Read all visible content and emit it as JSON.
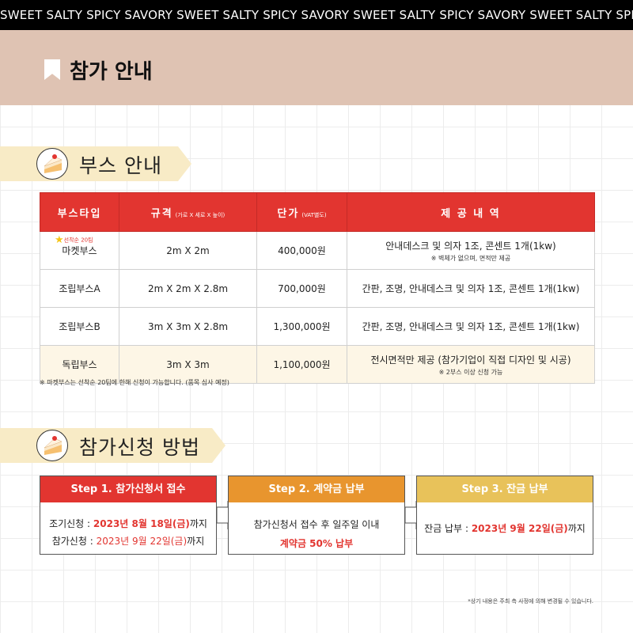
{
  "marquee": "SWEET SALTY SPICY SAVORY SWEET SALTY SPICY SAVORY SWEET SALTY SPICY SAVORY SWEET SALTY SPICY SAVORY",
  "header": {
    "title": "참가 안내"
  },
  "booth_section": {
    "title": "부스 안내"
  },
  "booth_table": {
    "headers": {
      "type": "부스타입",
      "size": "규격",
      "size_sub": "(가로 X 세로 X 높이)",
      "price": "단가",
      "price_sub": "(VAT별도)",
      "provide": "제 공 내 역"
    },
    "rows": [
      {
        "type": "마켓부스",
        "badge": "선착순 20팀",
        "size": "2m X 2m",
        "price": "400,000원",
        "provide": "안내데스크 및 의자 1조, 콘센트 1개(1kw)",
        "provide_sub": "※ 벽체가 없으며, 면적만 제공"
      },
      {
        "type": "조립부스A",
        "size": "2m X 2m X 2.8m",
        "price": "700,000원",
        "provide": "간판, 조명, 안내데스크 및 의자 1조, 콘센트 1개(1kw)"
      },
      {
        "type": "조립부스B",
        "size": "3m X 3m X 2.8m",
        "price": "1,300,000원",
        "provide": "간판, 조명, 안내데스크 및 의자 1조, 콘센트 1개(1kw)"
      },
      {
        "type": "독립부스",
        "size": "3m X 3m",
        "price": "1,100,000원",
        "provide": "전시면적만 제공 (참가기업이 직접 디자인 및 시공)",
        "provide_sub": "※ 2부스 이상 신청 가능"
      }
    ],
    "note": "※ 마켓부스는 선착순 20팀에 한해 신청이 가능합니다. (품목 심사 예정)"
  },
  "apply_section": {
    "title": "참가신청 방법"
  },
  "steps": [
    {
      "title": "Step 1. 참가신청서 접수",
      "color": "#e23530",
      "line1_label": "조기신청 : ",
      "line1_value": "2023년 8월 18일(금)",
      "line1_suffix": "까지",
      "line2_label": "참가신청 : ",
      "line2_value": "2023년 9월 22일(금)",
      "line2_suffix": "까지"
    },
    {
      "title": "Step 2. 계약금 납부",
      "color": "#e8952e",
      "line1": "참가신청서 접수 후 일주일 이내",
      "line2": "계약금 50% 납부"
    },
    {
      "title": "Step 3. 잔금 납부",
      "color": "#e8c25a",
      "line1_label": "잔금 납부 : ",
      "line1_value": "2023년 9월 22일(금)",
      "line1_suffix": "까지"
    }
  ],
  "footer_note": "*상기 내용은 주최 측 사정에 의해 변경될 수 있습니다."
}
